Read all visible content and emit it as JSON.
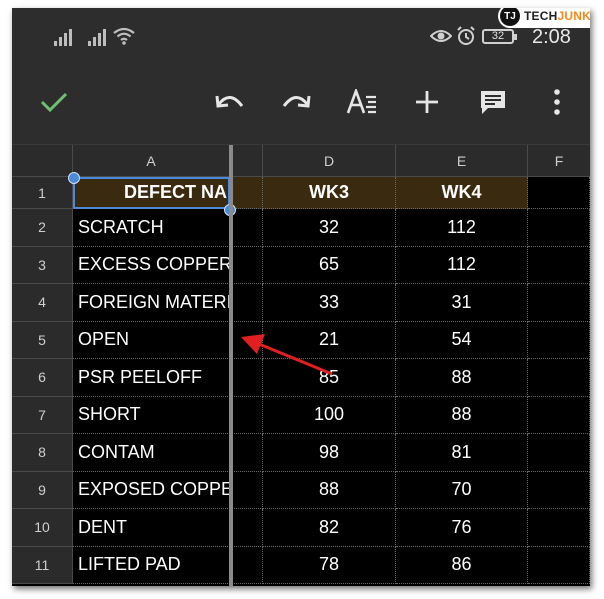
{
  "status_bar": {
    "watermark_letters": "TJ",
    "watermark_brand_a": "TECH",
    "watermark_brand_b": "JUNKIE",
    "battery": "32",
    "time": "2:08"
  },
  "toolbar": {
    "icons": [
      "check-icon",
      "undo-icon",
      "redo-icon",
      "text-format-icon",
      "add-icon",
      "comment-icon",
      "more-vert-icon"
    ]
  },
  "sheet": {
    "columns": [
      "A",
      "D",
      "E",
      "F"
    ],
    "rows": [
      {
        "num": "1",
        "defect": "DEFECT NA",
        "wk3": "WK3",
        "wk4": "WK4"
      },
      {
        "num": "2",
        "defect": "SCRATCH",
        "wk3": "32",
        "wk4": "112"
      },
      {
        "num": "3",
        "defect": "EXCESS COPPER",
        "wk3": "65",
        "wk4": "112"
      },
      {
        "num": "4",
        "defect": "FOREIGN MATERIA",
        "wk3": "33",
        "wk4": "31"
      },
      {
        "num": "5",
        "defect": "OPEN",
        "wk3": "21",
        "wk4": "54"
      },
      {
        "num": "6",
        "defect": "PSR PEELOFF",
        "wk3": "85",
        "wk4": "88"
      },
      {
        "num": "7",
        "defect": "SHORT",
        "wk3": "100",
        "wk4": "88"
      },
      {
        "num": "8",
        "defect": "CONTAM",
        "wk3": "98",
        "wk4": "81"
      },
      {
        "num": "9",
        "defect": "EXPOSED COPPE",
        "wk3": "88",
        "wk4": "70"
      },
      {
        "num": "10",
        "defect": "DENT",
        "wk3": "82",
        "wk4": "76"
      },
      {
        "num": "11",
        "defect": "LIFTED PAD",
        "wk3": "78",
        "wk4": "86"
      }
    ]
  },
  "colors": {
    "header_row_fill": "#3a2b10",
    "selection": "#4a8ad8",
    "annotation_arrow": "#e02020",
    "toolbar_check": "#6fbf73"
  }
}
